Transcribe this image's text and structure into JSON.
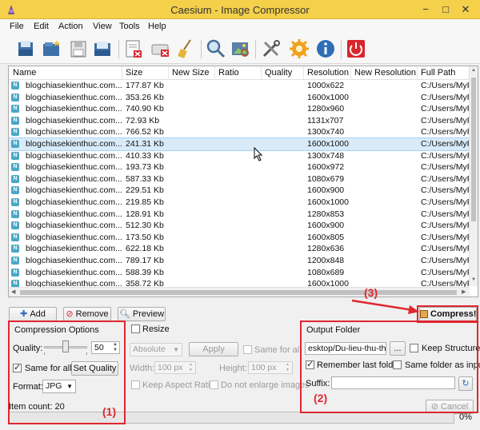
{
  "window": {
    "title": "Caesium - Image Compressor",
    "minimize": "−",
    "maximize": "□",
    "close": "✕"
  },
  "menu": [
    "File",
    "Edit",
    "Action",
    "View",
    "Tools",
    "Help"
  ],
  "toolbar": {
    "icons": [
      "open-file-icon",
      "add-folder-icon",
      "save-icon",
      "save-list-icon",
      "remove-item-icon",
      "clear-list-icon",
      "clean-icon",
      "search-icon",
      "preview-image-icon",
      "tools-icon",
      "settings-icon",
      "info-icon",
      "exit-icon"
    ]
  },
  "columns": [
    "Name",
    "Size",
    "New Size",
    "Ratio",
    "Quality",
    "Resolution",
    "New Resolution",
    "Full Path"
  ],
  "rows": [
    {
      "name": "blogchiasekienthuc.com...",
      "size": "177.87 Kb",
      "res": "1000x622",
      "path": "C:/Users/MyP"
    },
    {
      "name": "blogchiasekienthuc.com...",
      "size": "353.26 Kb",
      "res": "1600x1000",
      "path": "C:/Users/MyP"
    },
    {
      "name": "blogchiasekienthuc.com...",
      "size": "740.90 Kb",
      "res": "1280x960",
      "path": "C:/Users/MyP"
    },
    {
      "name": "blogchiasekienthuc.com...",
      "size": "72.93 Kb",
      "res": "1131x707",
      "path": "C:/Users/MyP"
    },
    {
      "name": "blogchiasekienthuc.com...",
      "size": "766.52 Kb",
      "res": "1300x740",
      "path": "C:/Users/MyP"
    },
    {
      "name": "blogchiasekienthuc.com...",
      "size": "241.31 Kb",
      "res": "1600x1000",
      "path": "C:/Users/MyP"
    },
    {
      "name": "blogchiasekienthuc.com...",
      "size": "410.33 Kb",
      "res": "1300x748",
      "path": "C:/Users/MyP"
    },
    {
      "name": "blogchiasekienthuc.com...",
      "size": "193.73 Kb",
      "res": "1600x972",
      "path": "C:/Users/MyP"
    },
    {
      "name": "blogchiasekienthuc.com...",
      "size": "587.33 Kb",
      "res": "1080x679",
      "path": "C:/Users/MyP"
    },
    {
      "name": "blogchiasekienthuc.com...",
      "size": "229.51 Kb",
      "res": "1600x900",
      "path": "C:/Users/MyP"
    },
    {
      "name": "blogchiasekienthuc.com...",
      "size": "219.85 Kb",
      "res": "1600x1000",
      "path": "C:/Users/MyP"
    },
    {
      "name": "blogchiasekienthuc.com...",
      "size": "128.91 Kb",
      "res": "1280x853",
      "path": "C:/Users/MyP"
    },
    {
      "name": "blogchiasekienthuc.com...",
      "size": "512.30 Kb",
      "res": "1600x900",
      "path": "C:/Users/MyP"
    },
    {
      "name": "blogchiasekienthuc.com...",
      "size": "173.50 Kb",
      "res": "1600x805",
      "path": "C:/Users/MyP"
    },
    {
      "name": "blogchiasekienthuc.com...",
      "size": "622.18 Kb",
      "res": "1280x636",
      "path": "C:/Users/MyP"
    },
    {
      "name": "blogchiasekienthuc.com...",
      "size": "789.17 Kb",
      "res": "1200x848",
      "path": "C:/Users/MyP"
    },
    {
      "name": "blogchiasekienthuc.com...",
      "size": "588.39 Kb",
      "res": "1080x689",
      "path": "C:/Users/MyP"
    },
    {
      "name": "blogchiasekienthuc.com...",
      "size": "358.72 Kb",
      "res": "1600x1000",
      "path": "C:/Users/MyP"
    }
  ],
  "selected_row": 5,
  "list_buttons": {
    "add": "Add",
    "remove": "Remove",
    "preview": "Preview",
    "compress": "Compress!"
  },
  "compression": {
    "title": "Compression Options",
    "quality_label": "Quality:",
    "quality_value": "50",
    "quality_fraction": 0.5,
    "same_for_all": "Same for all",
    "set_quality": "Set Quality",
    "format_label": "Format:",
    "format_value": "JPG"
  },
  "resize": {
    "title": "Resize",
    "mode": "Absolute",
    "apply": "Apply",
    "same_for_all": "Same for all",
    "width_label": "Width:",
    "width_value": "100 px",
    "height_label": "Height:",
    "height_value": "100 px",
    "keep_aspect": "Keep Aspect Ratio",
    "no_enlarge": "Do not enlarge images"
  },
  "output": {
    "title": "Output Folder",
    "path": "esktop/Du-lieu-thu-thuat",
    "browse": "...",
    "keep_structure": "Keep Structure",
    "remember": "Remember last folder",
    "same_folder": "Same folder as input",
    "suffix_label": "Suffix:",
    "suffix_value": "",
    "cancel": "Cancel"
  },
  "status": {
    "item_count": "Item count: 20",
    "progress": "0%",
    "progress_value": 0
  },
  "annotations": {
    "one": "(1)",
    "two": "(2)",
    "three": "(3)"
  },
  "colors": {
    "titlebar": "#f4d04b",
    "annotation": "#e0262f",
    "selection": "#d9ebf9"
  }
}
